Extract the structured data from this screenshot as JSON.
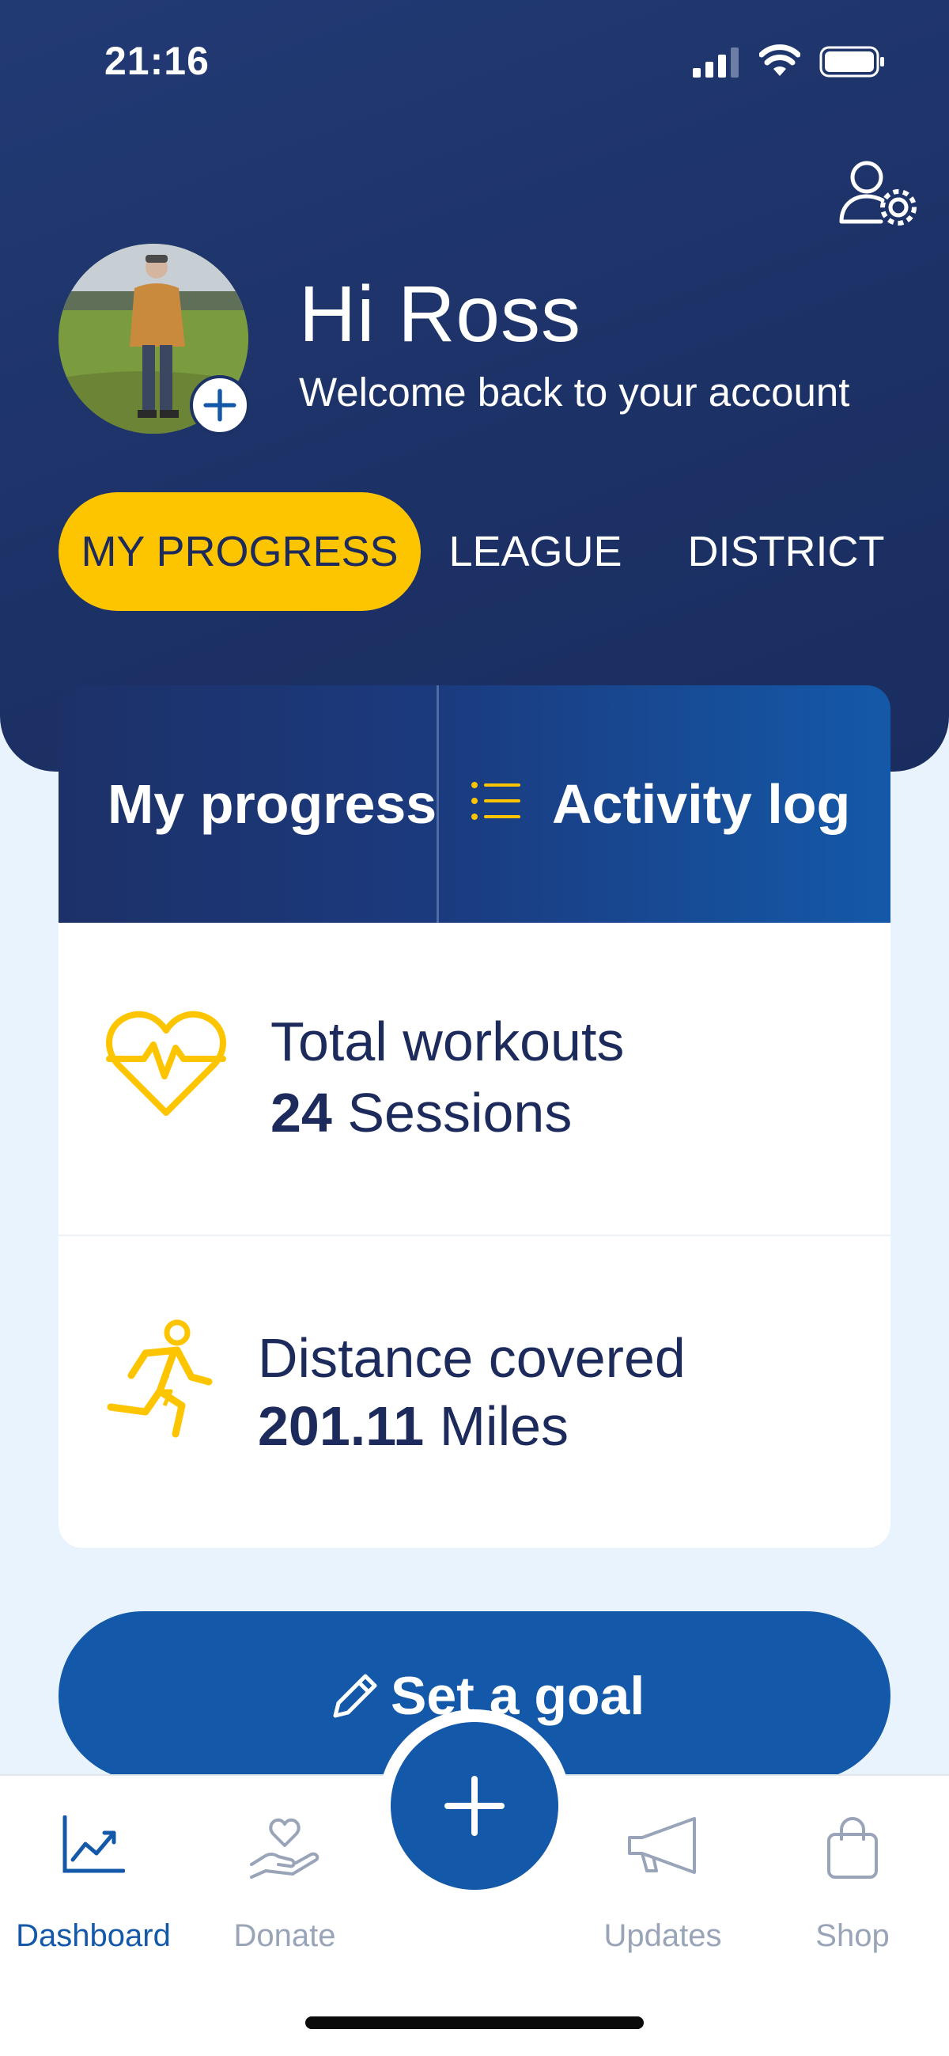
{
  "status_bar": {
    "time": "21:16"
  },
  "header": {
    "greeting": "Hi Ross",
    "subtitle": "Welcome back to your account",
    "tabs": [
      {
        "label": "MY PROGRESS",
        "active": true
      },
      {
        "label": "LEAGUE",
        "active": false
      },
      {
        "label": "DISTRICT",
        "active": false
      }
    ]
  },
  "card": {
    "tabs": [
      {
        "label": "My progress",
        "icon": "none"
      },
      {
        "label": "Activity log",
        "icon": "list-icon"
      }
    ],
    "stats": [
      {
        "label": "Total workouts",
        "value": "24",
        "unit": "Sessions",
        "icon": "heart-pulse-icon"
      },
      {
        "label": "Distance covered",
        "value": "201.11",
        "unit": "Miles",
        "icon": "runner-icon"
      }
    ]
  },
  "goal_button": {
    "label": "Set a goal",
    "icon": "pencil-icon"
  },
  "bottom_nav": {
    "items": [
      {
        "label": "Dashboard",
        "icon": "chart-icon",
        "active": true
      },
      {
        "label": "Donate",
        "icon": "donate-icon",
        "active": false
      },
      {
        "label": "Updates",
        "icon": "megaphone-icon",
        "active": false
      },
      {
        "label": "Shop",
        "icon": "shopping-bag-icon",
        "active": false
      }
    ],
    "fab_icon": "plus-icon"
  },
  "colors": {
    "header_bg": "#1c3166",
    "accent_yellow": "#fdc500",
    "primary_blue": "#1459a9",
    "text_dark": "#1d2b5c"
  }
}
